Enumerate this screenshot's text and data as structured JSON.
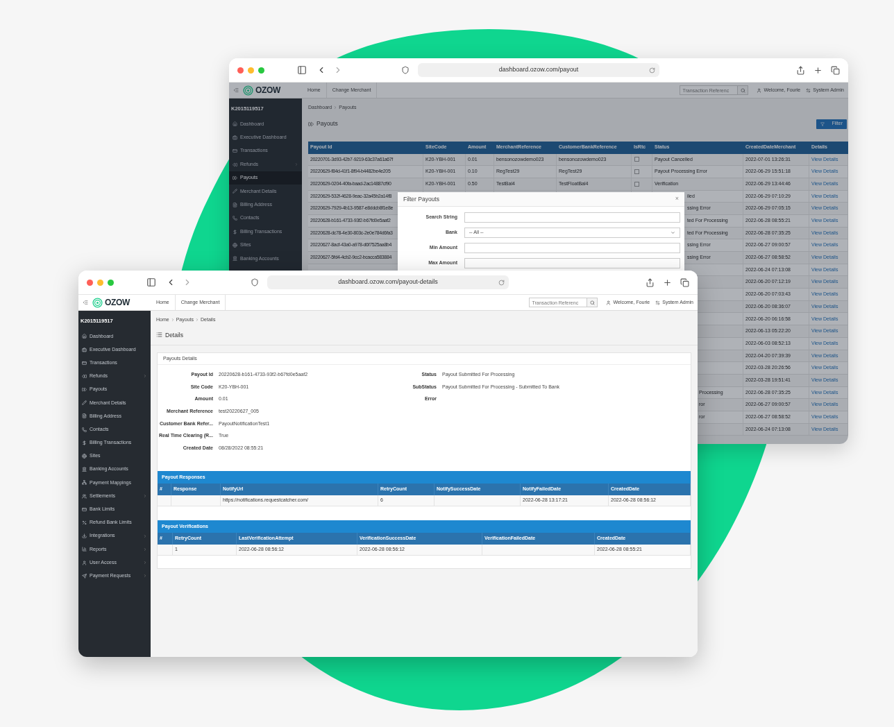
{
  "back_window": {
    "url": "dashboard.ozow.com/payout",
    "logo": "OZOW",
    "nav_links": [
      "Home",
      "Change Merchant"
    ],
    "search": {
      "placeholder": "Transaction Referenc"
    },
    "user": "Welcome, Fourie",
    "role": "System Admin",
    "merchant_id": "K2015119517",
    "sidebar": {
      "items": [
        {
          "label": "Dashboard",
          "kind": "link",
          "selected": false
        },
        {
          "label": "Executive Dashboard",
          "kind": "link",
          "selected": false
        },
        {
          "label": "Transactions",
          "kind": "link",
          "selected": false
        },
        {
          "label": "Refunds",
          "kind": "group",
          "selected": false
        },
        {
          "label": "Payouts",
          "kind": "link",
          "selected": true
        },
        {
          "label": "Merchant Details",
          "kind": "link",
          "selected": false
        },
        {
          "label": "Billing Address",
          "kind": "link",
          "selected": false
        },
        {
          "label": "Contacts",
          "kind": "link",
          "selected": false
        },
        {
          "label": "Billing Transactions",
          "kind": "link",
          "selected": false
        },
        {
          "label": "Sites",
          "kind": "link",
          "selected": false
        },
        {
          "label": "Banking Accounts",
          "kind": "link",
          "selected": false
        }
      ]
    },
    "breadcrumb": [
      "Dashboard",
      "Payouts"
    ],
    "heading": "Payouts",
    "filter_button": "Filter",
    "table": {
      "columns": [
        "Payout Id",
        "SiteCode",
        "Amount",
        "MerchantReference",
        "CustomerBankReference",
        "IsRtc",
        "Status",
        "CreatedDateMerchant",
        "Details"
      ],
      "rows": [
        {
          "payout_id": "20220701-3d93-42b7-9219-63c37a61a67f",
          "site_code": "K20-YBH-001",
          "amount": "0.01",
          "merchant_reference": "bensonozowdemo023",
          "customer_bank_reference": "bensonozowdemo023",
          "is_rtc": {
            "checked": false
          },
          "status": "Payout Cancelled",
          "created": "2022-07-01 13:26:31",
          "details": "View Details"
        },
        {
          "payout_id": "20220629-f84d-41f1-8f94-b4482be4e205",
          "site_code": "K20-YBH-001",
          "amount": "0.10",
          "merchant_reference": "RegTest29",
          "customer_bank_reference": "RegTest29",
          "is_rtc": {
            "checked": false
          },
          "status": "Payout Processing Error",
          "created": "2022-06-29 15:51:18",
          "details": "View Details"
        },
        {
          "payout_id": "20220629-0204-40fa-baad-2ac14887cf90",
          "site_code": "K20-YBH-001",
          "amount": "0.50",
          "merchant_reference": "TestBal4",
          "customer_bank_reference": "TestFloatBal4",
          "is_rtc": {
            "checked": false
          },
          "status": "Verification",
          "created": "2022-06-29 13:44:46",
          "details": "View Details"
        },
        {
          "payout_id": "20220629-532f-4628-9eac-32a45b2a14f8",
          "status": "iled",
          "created": "2022-06-29 07:10:29",
          "details": "View Details"
        },
        {
          "payout_id": "20220629-7929-4b13-9587-e8ddcb8f1e8e",
          "status": "ssing Error",
          "created": "2022-06-29 07:05:15",
          "details": "View Details"
        },
        {
          "payout_id": "20220628-b161-4733-93f2-b67fd0e5aaf2",
          "status": "ted For Processing",
          "created": "2022-06-28 08:55:21",
          "details": "View Details"
        },
        {
          "payout_id": "20220628-dc78-4e30-803c-2e0e784d6fa3",
          "status": "ted For Processing",
          "created": "2022-06-28 07:35:25",
          "details": "View Details"
        },
        {
          "payout_id": "20220627-8acf-43a0-a978-d6f7525aa8b4",
          "status": "ssing Error",
          "created": "2022-06-27 09:00:57",
          "details": "View Details"
        },
        {
          "payout_id": "20220627-5fd4-4cb2-9cc2-bcacca583884",
          "status": "ssing Error",
          "created": "2022-06-27 08:58:52",
          "details": "View Details"
        },
        {
          "created": "2022-06-24 07:13:08",
          "details": "View Details"
        },
        {
          "created": "2022-06-20 07:12:19",
          "details": "View Details"
        },
        {
          "created": "2022-06-20 07:03:43",
          "details": "View Details"
        },
        {
          "created": "2022-06-20 08:36:07",
          "details": "View Details"
        },
        {
          "created": "2022-06-20 06:16:58",
          "details": "View Details"
        },
        {
          "created": "2022-06-13 05:22:20",
          "details": "View Details"
        },
        {
          "created": "2022-06-03 08:52:13",
          "details": "View Details"
        },
        {
          "created": "2022-04-20 07:39:39",
          "details": "View Details"
        },
        {
          "created": "2022-03-28 20:26:56",
          "details": "View Details"
        },
        {
          "created": "2022-03-28 19:51:41",
          "details": "View Details"
        },
        {
          "status": "Processing",
          "created": "2022-06-28 07:35:25",
          "details": "View Details"
        },
        {
          "status": "ror",
          "created": "2022-06-27 09:00:57",
          "details": "View Details"
        },
        {
          "status": "ror",
          "created": "2022-06-27 08:58:52",
          "details": "View Details"
        },
        {
          "created": "2022-06-24 07:13:08",
          "details": "View Details"
        }
      ]
    },
    "dialog": {
      "title": "Filter Payouts",
      "close": "×",
      "fields": [
        {
          "label": "Search String",
          "kind": "text"
        },
        {
          "label": "Bank",
          "kind": "select",
          "value": "-- All --"
        },
        {
          "label": "Min Amount",
          "kind": "text"
        },
        {
          "label": "Max Amount",
          "kind": "text"
        }
      ]
    }
  },
  "front_window": {
    "url": "dashboard.ozow.com/payout-details",
    "logo": "OZOW",
    "nav_links": [
      "Home",
      "Change Merchant"
    ],
    "search": {
      "placeholder": "Transaction Referenc"
    },
    "user": "Welcome, Fourie",
    "role": "System Admin",
    "merchant_id": "K2015119517",
    "sidebar": {
      "items": [
        {
          "label": "Dashboard",
          "kind": "link",
          "selected": false
        },
        {
          "label": "Executive Dashboard",
          "kind": "link",
          "selected": false
        },
        {
          "label": "Transactions",
          "kind": "link",
          "selected": false
        },
        {
          "label": "Refunds",
          "kind": "group",
          "selected": false
        },
        {
          "label": "Payouts",
          "kind": "link",
          "selected": false
        },
        {
          "label": "Merchant Details",
          "kind": "link",
          "selected": false
        },
        {
          "label": "Billing Address",
          "kind": "link",
          "selected": false
        },
        {
          "label": "Contacts",
          "kind": "link",
          "selected": false
        },
        {
          "label": "Billing Transactions",
          "kind": "link",
          "selected": false
        },
        {
          "label": "Sites",
          "kind": "link",
          "selected": false
        },
        {
          "label": "Banking Accounts",
          "kind": "link",
          "selected": false
        },
        {
          "label": "Payment Mappings",
          "kind": "link",
          "selected": false
        },
        {
          "label": "Settlements",
          "kind": "group",
          "selected": false
        },
        {
          "label": "Bank Limits",
          "kind": "link",
          "selected": false
        },
        {
          "label": "Refund Bank Limits",
          "kind": "link",
          "selected": false
        },
        {
          "label": "Integrations",
          "kind": "group",
          "selected": false
        },
        {
          "label": "Reports",
          "kind": "group",
          "selected": false
        },
        {
          "label": "User Access",
          "kind": "group",
          "selected": false
        },
        {
          "label": "Payment Requests",
          "kind": "group",
          "selected": false
        }
      ]
    },
    "breadcrumb": [
      "Home",
      "Payouts",
      "Details"
    ],
    "heading": "Details",
    "details_panel": {
      "title": "Payouts Details",
      "left_fields": [
        {
          "label": "Payout Id",
          "value": "20220628-b161-4733-93f2-b67fd0e5aaf2"
        },
        {
          "label": "Site Code",
          "value": "K20-YBH-001"
        },
        {
          "label": "Amount",
          "value": "0.01"
        },
        {
          "label": "Merchant Reference",
          "value": "test20220627_005"
        },
        {
          "label": "Customer Bank Refer...",
          "value": "PayoutNotificationTest1"
        },
        {
          "label": "Real Time Clearing (R...",
          "value": "True"
        },
        {
          "label": "Created Date",
          "value": "08/28/2022 08:55:21"
        }
      ],
      "right_fields": [
        {
          "label": "Status",
          "value": "Payout Submitted For Processing"
        },
        {
          "label": "SubStatus",
          "value": "Payout Submitted For Processing - Submitted To Bank"
        },
        {
          "label": "Error"
        }
      ]
    },
    "responses": {
      "title": "Payout Responses",
      "columns": [
        "#",
        "Response",
        "NotifyUrl",
        "RetryCount",
        "NotifySuccessDate",
        "NotifyFailedDate",
        "CreatedDate"
      ],
      "rows": [
        [
          null,
          null,
          "https://notifications.requestcatcher.com/",
          "6",
          null,
          "2022-06-28 13:17:21",
          "2022-06-28 08:56:12"
        ]
      ]
    },
    "verifications": {
      "title": "Payout Verifications",
      "columns": [
        "#",
        "RetryCount",
        "LastVerificationAttempt",
        "VerificationSuccessDate",
        "VerificationFailedDate",
        "CreatedDate"
      ],
      "rows": [
        [
          null,
          "1",
          "2022-06-28 08:56:12",
          "2022-06-28 08:56:12",
          null,
          "2022-06-28 08:55:21"
        ]
      ]
    }
  }
}
